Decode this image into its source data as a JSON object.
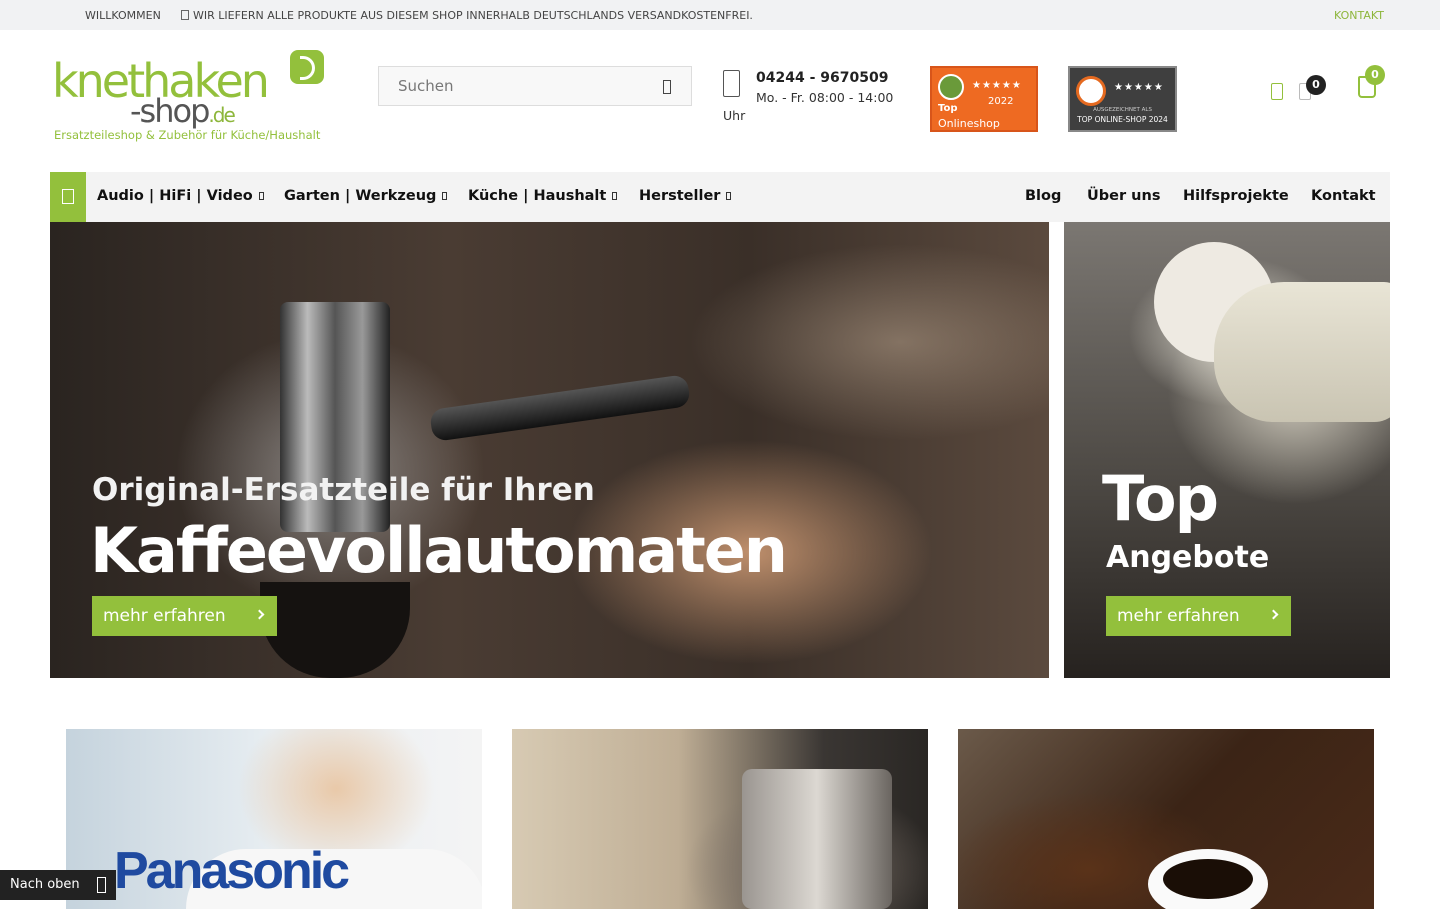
{
  "topbar": {
    "welcome": "WILLKOMMEN",
    "shipping": "WIR LIEFERN ALLE PRODUKTE AUS DIESEM SHOP INNERHALB DEUTSCHLANDS VERSANDKOSTENFREI.",
    "contact": "KONTAKT"
  },
  "logo": {
    "word1": "knethaken",
    "word2": "-shop",
    "tld": ".de",
    "tagline": "Ersatzteileshop & Zubehör für Küche/Haushalt"
  },
  "search": {
    "placeholder": "Suchen",
    "icon": "search-icon"
  },
  "contact_info": {
    "phone": "04244 - 9670509",
    "hours": "Mo. - Fr. 08:00 - 14:00",
    "hours_suffix": "Uhr"
  },
  "badges": {
    "first": {
      "stars": "★★★★★",
      "year": "2022",
      "top": "Top",
      "label": "Onlineshop"
    },
    "second": {
      "stars": "★★★★★",
      "small": "AUSGEZEICHNET ALS",
      "label": "TOP ONLINE-SHOP 2024"
    }
  },
  "header_icons": {
    "compare_count": "0",
    "cart_count": "0"
  },
  "nav": {
    "left": [
      {
        "label": "Audio | HiFi | Video"
      },
      {
        "label": "Garten | Werkzeug"
      },
      {
        "label": "Küche | Haushalt"
      },
      {
        "label": "Hersteller"
      }
    ],
    "right": [
      {
        "label": "Blog"
      },
      {
        "label": "Über uns"
      },
      {
        "label": "Hilfsprojekte"
      },
      {
        "label": "Kontakt"
      }
    ]
  },
  "hero": {
    "line1": "Original-Ersatzteile für Ihren",
    "line2": "Kaffeevollautomaten",
    "button": "mehr erfahren"
  },
  "side_banner": {
    "line1": "Top",
    "line2": "Angebote",
    "button": "mehr erfahren"
  },
  "tiles": [
    {
      "brand": "Panasonic"
    }
  ],
  "back_to_top": "Nach oben",
  "colors": {
    "accent": "#93c03c",
    "badge_orange": "#ee6a22",
    "badge_dark": "#3f3f3f"
  }
}
